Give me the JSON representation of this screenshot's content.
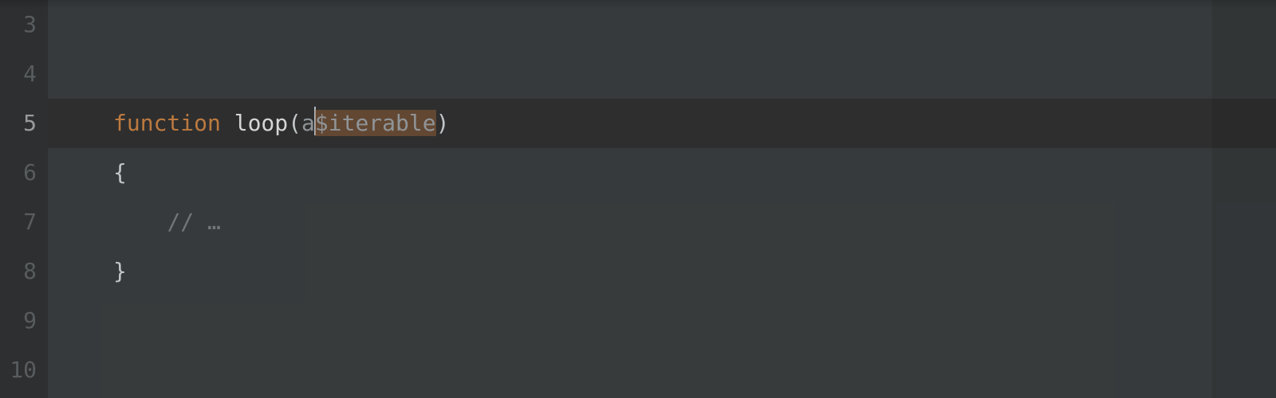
{
  "gutter": {
    "start": 3,
    "active": 5,
    "numbers": [
      "3",
      "4",
      "5",
      "6",
      "7",
      "8",
      "9",
      "10"
    ]
  },
  "code": {
    "line5": {
      "keyword": "function",
      "space1": " ",
      "fnname": "loop",
      "open": "(",
      "typed": "a",
      "selected": "$iterable",
      "close": ")"
    },
    "line6": "{",
    "line7_indent": "    ",
    "line7_comment": "// …",
    "line8": "}"
  }
}
